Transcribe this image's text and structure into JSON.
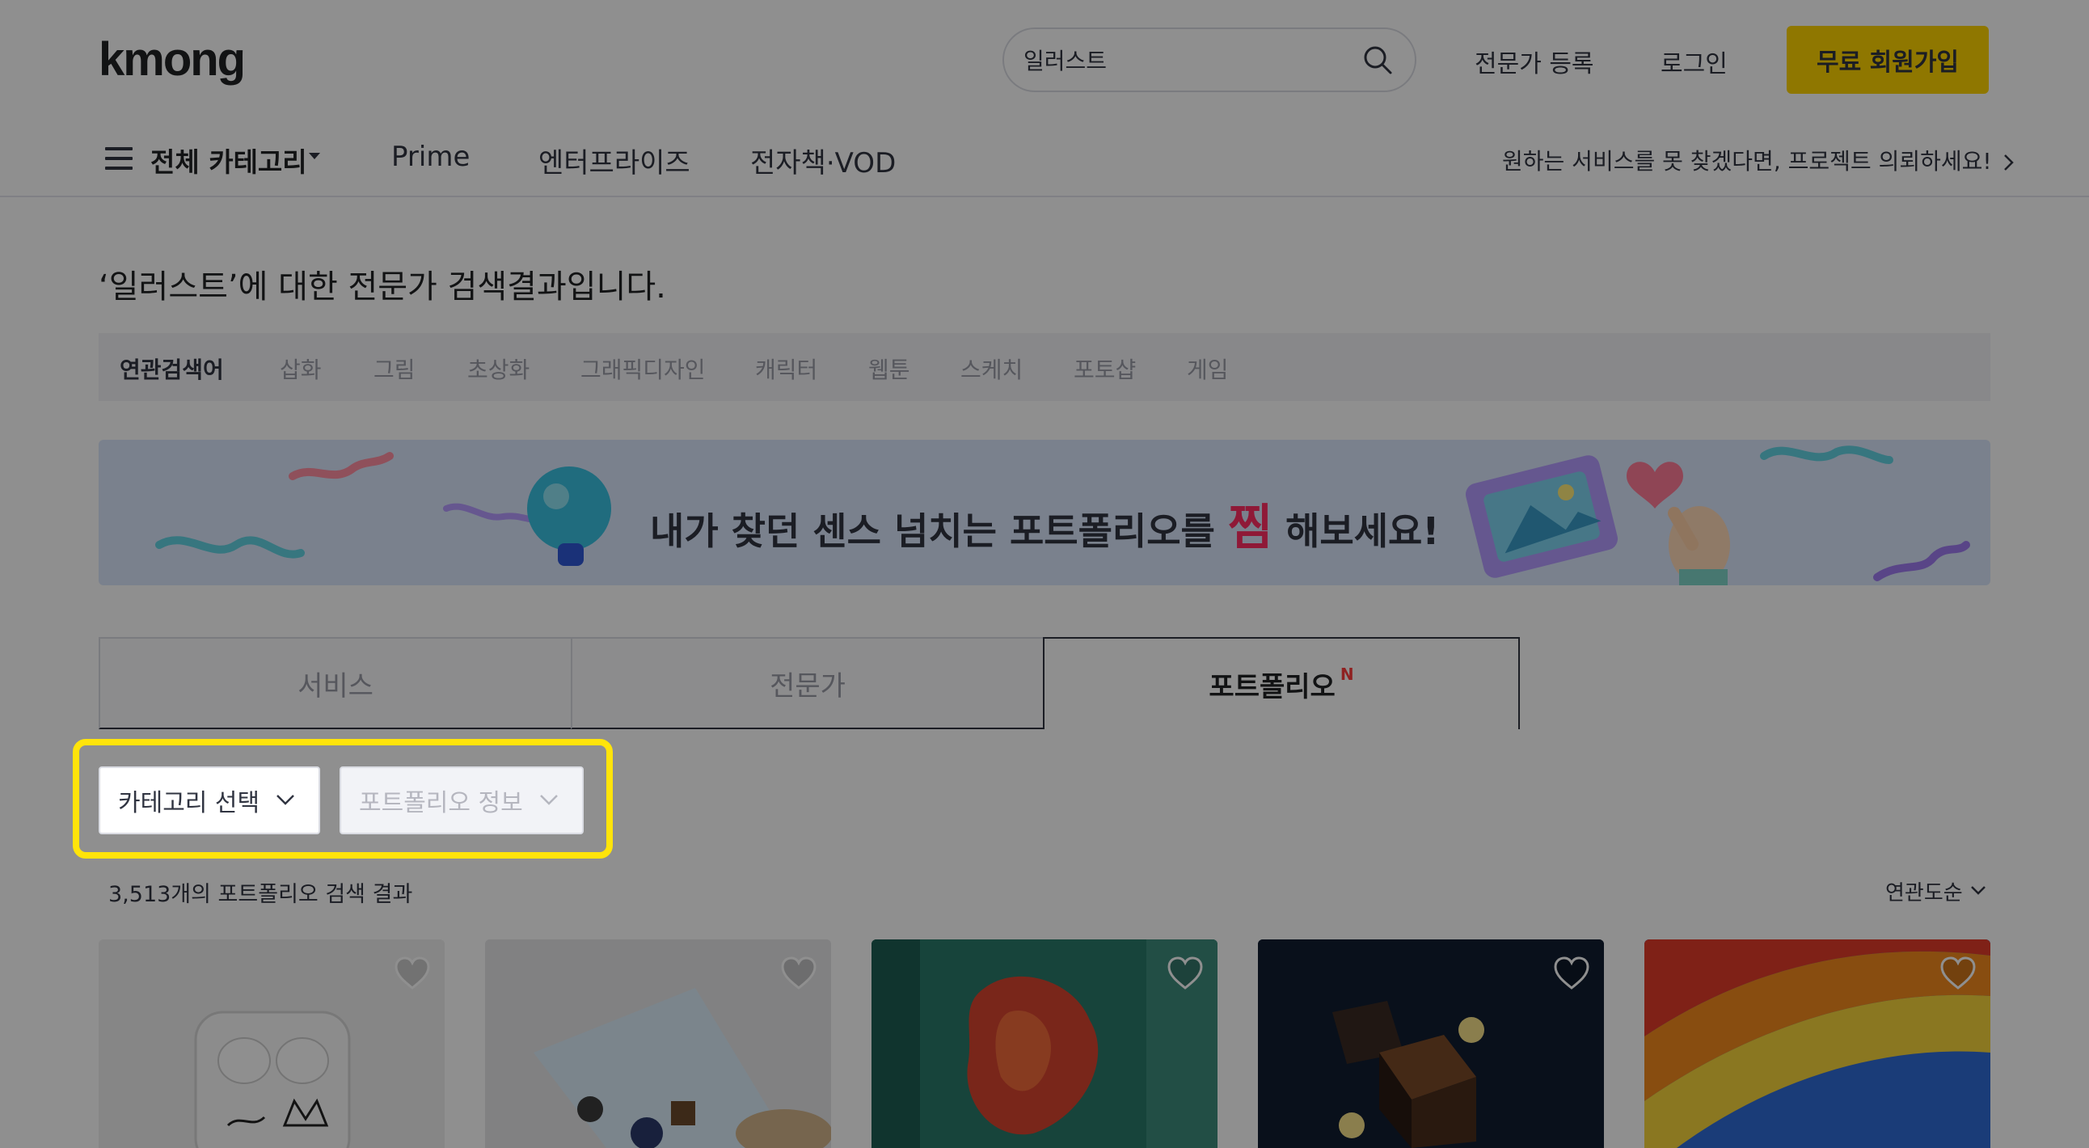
{
  "header": {
    "logo": "kmong",
    "search_value": "일러스트",
    "expert_register": "전문가 등록",
    "login": "로그인",
    "signup": "무료 회원가입"
  },
  "nav": {
    "all_categories": "전체 카테고리",
    "links": [
      "Prime",
      "엔터프라이즈",
      "전자책·VOD"
    ],
    "project_request": "원하는 서비스를 못 찾겠다면, 프로젝트 의뢰하세요!"
  },
  "page_title": "‘일러스트’에 대한 전문가 검색결과입니다.",
  "related": {
    "label": "연관검색어",
    "keywords": [
      "삽화",
      "그림",
      "초상화",
      "그래픽디자인",
      "캐릭터",
      "웹툰",
      "스케치",
      "포토샵",
      "게임"
    ]
  },
  "banner": {
    "text_before": "내가 찾던 센스 넘치는 포트폴리오를",
    "text_emph": "찜",
    "text_after": "해보세요!"
  },
  "tabs": [
    {
      "label": "서비스",
      "active": false
    },
    {
      "label": "전문가",
      "active": false
    },
    {
      "label": "포트폴리오",
      "active": true,
      "badge": "N"
    }
  ],
  "filters": {
    "category": "카테고리 선택",
    "portfolio_info": "포트폴리오 정보"
  },
  "results": {
    "count_text": "3,513개의 포트폴리오 검색 결과",
    "sort_label": "연관도순"
  },
  "colors": {
    "accent": "#ffd400",
    "highlight": "#ffe40a",
    "new_badge": "#ff3b3b"
  }
}
